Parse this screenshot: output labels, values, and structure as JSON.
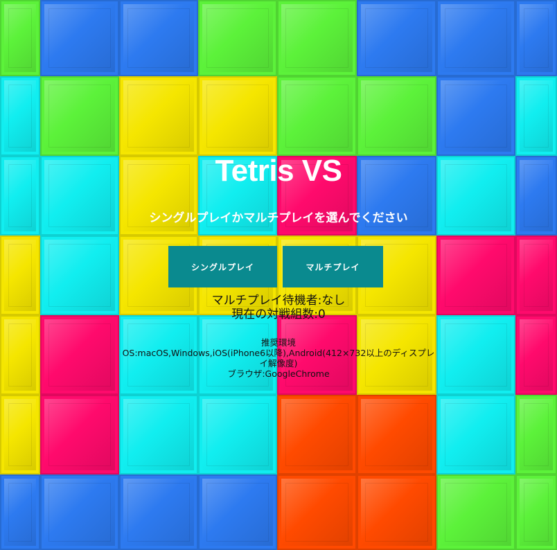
{
  "title": "Tetris VS",
  "subtitle": "シングルプレイかマルチプレイを選んでください",
  "buttons": {
    "single": "シングルプレイ",
    "multi": "マルチプレイ"
  },
  "status": {
    "waiting": "マルチプレイ待機者:なし",
    "matches": "現在の対戦組数:0"
  },
  "environment": {
    "heading": "推奨環境",
    "os": "OS:macOS,Windows,iOS(iPhone6以降),Android(412×732以上のディスプレイ解像度)",
    "browser": "ブラウザ:GoogleChrome"
  },
  "colors": {
    "accent_button": "#0a8a8f",
    "tiles": [
      "#5cf23a",
      "#2d7af0",
      "#11eef0",
      "#f5e600",
      "#ff0a6c",
      "#ff4a00"
    ]
  }
}
